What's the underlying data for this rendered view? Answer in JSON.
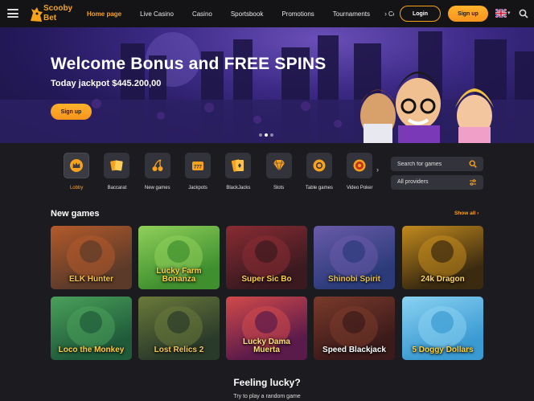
{
  "header": {
    "logo_text_1": "Scooby",
    "logo_text_2": "Bet",
    "nav": [
      "Home page",
      "Live Casino",
      "Casino",
      "Sportsbook",
      "Promotions",
      "Tournaments",
      "Cor"
    ],
    "active_nav": "Home page",
    "login_label": "Login",
    "signup_label": "Sign up",
    "language_icon": "uk-flag-icon",
    "accent_color": "#f7a21c"
  },
  "hero": {
    "title": "Welcome Bonus and FREE SPINS",
    "jackpot": "Today jackpot $445.200,00",
    "cta_label": "Sign up",
    "slides": 3,
    "active_slide": 1
  },
  "categories": [
    {
      "label": "Lobby",
      "icon": "crown-icon",
      "active": true
    },
    {
      "label": "Baccarat",
      "icon": "cards-icon",
      "active": false
    },
    {
      "label": "New games",
      "icon": "cherries-icon",
      "active": false
    },
    {
      "label": "Jackpots",
      "icon": "jackpot-icon",
      "active": false
    },
    {
      "label": "BlackJacks",
      "icon": "playing-cards-icon",
      "active": false
    },
    {
      "label": "Slots",
      "icon": "diamond-icon",
      "active": false
    },
    {
      "label": "Table games",
      "icon": "poker-chip-icon",
      "active": false
    },
    {
      "label": "Video Poker",
      "icon": "roulette-icon",
      "active": false
    }
  ],
  "filters": {
    "search_placeholder": "Search for games",
    "providers_label": "All providers"
  },
  "new_games": {
    "title": "New games",
    "show_all": "Show all",
    "games": [
      {
        "name": "ELK Hunter",
        "bg": "#5b3a2a",
        "bg2": "#b35a2a",
        "text_color": "#f5c246"
      },
      {
        "name": "Lucky Farm Bonanza",
        "bg": "#3f8f2f",
        "bg2": "#8fd05a",
        "text_color": "#ffd23a"
      },
      {
        "name": "Super Sic Bo",
        "bg": "#3a1a20",
        "bg2": "#8a2b33",
        "text_color": "#ffcf4a"
      },
      {
        "name": "Shinobi Spirit",
        "bg": "#2b3b7a",
        "bg2": "#6a5aa8",
        "text_color": "#e9c04a"
      },
      {
        "name": "24k Dragon",
        "bg": "#3a2a10",
        "bg2": "#c28a1e",
        "text_color": "#ffd76a"
      },
      {
        "name": "Loco the Monkey",
        "bg": "#1f5a3a",
        "bg2": "#4aa15a",
        "text_color": "#ffcf3a"
      },
      {
        "name": "Lost Relics 2",
        "bg": "#2a3a2a",
        "bg2": "#6a7a3a",
        "text_color": "#f3c657"
      },
      {
        "name": "Lucky Dama Muerta",
        "bg": "#5a1a4a",
        "bg2": "#d24a4a",
        "text_color": "#ffe07a"
      },
      {
        "name": "Speed Blackjack",
        "bg": "#3a1a1a",
        "bg2": "#7a3a2a",
        "text_color": "#ffffff"
      },
      {
        "name": "5 Doggy Dollars",
        "bg": "#3a9ad2",
        "bg2": "#8ad2f2",
        "text_color": "#ffd23a"
      }
    ]
  },
  "lucky": {
    "title": "Feeling lucky?",
    "subtitle": "Try to play a random game"
  }
}
